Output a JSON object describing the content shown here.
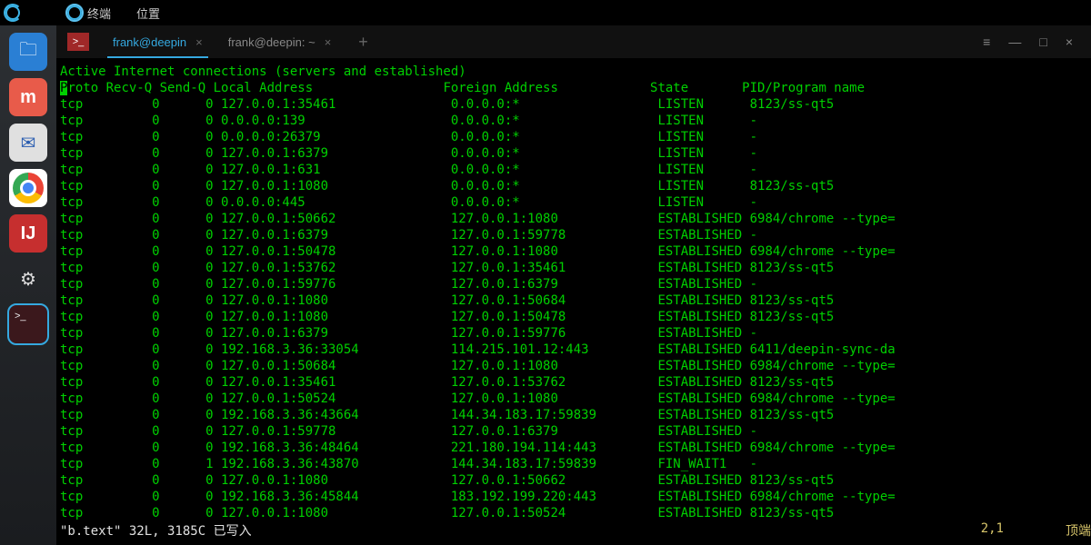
{
  "topbar": {
    "menu_terminal": "终端",
    "menu_location": "位置"
  },
  "dock": {
    "store_label": "m",
    "ij_label": "IJ"
  },
  "tabs": {
    "badge": ">_",
    "active": "frank@deepin",
    "inactive": "frank@deepin: ~",
    "close": "×",
    "plus": "+"
  },
  "winctrls": {
    "menu": "≡",
    "min": "—",
    "max": "□",
    "close": "×"
  },
  "term": {
    "title": "Active Internet connections (servers and established)",
    "headers": {
      "proto": "Proto",
      "recvq": "Recv-Q",
      "sendq": "Send-Q",
      "local": "Local Address",
      "foreign": "Foreign Address",
      "state": "State",
      "pid": "PID/Program name"
    },
    "rows": [
      {
        "proto": "tcp",
        "recv": "0",
        "send": "0",
        "local": "127.0.0.1:35461",
        "foreign": "0.0.0.0:*",
        "state": "LISTEN",
        "pid": "8123/ss-qt5"
      },
      {
        "proto": "tcp",
        "recv": "0",
        "send": "0",
        "local": "0.0.0.0:139",
        "foreign": "0.0.0.0:*",
        "state": "LISTEN",
        "pid": "-"
      },
      {
        "proto": "tcp",
        "recv": "0",
        "send": "0",
        "local": "0.0.0.0:26379",
        "foreign": "0.0.0.0:*",
        "state": "LISTEN",
        "pid": "-"
      },
      {
        "proto": "tcp",
        "recv": "0",
        "send": "0",
        "local": "127.0.0.1:6379",
        "foreign": "0.0.0.0:*",
        "state": "LISTEN",
        "pid": "-"
      },
      {
        "proto": "tcp",
        "recv": "0",
        "send": "0",
        "local": "127.0.0.1:631",
        "foreign": "0.0.0.0:*",
        "state": "LISTEN",
        "pid": "-"
      },
      {
        "proto": "tcp",
        "recv": "0",
        "send": "0",
        "local": "127.0.0.1:1080",
        "foreign": "0.0.0.0:*",
        "state": "LISTEN",
        "pid": "8123/ss-qt5"
      },
      {
        "proto": "tcp",
        "recv": "0",
        "send": "0",
        "local": "0.0.0.0:445",
        "foreign": "0.0.0.0:*",
        "state": "LISTEN",
        "pid": "-"
      },
      {
        "proto": "tcp",
        "recv": "0",
        "send": "0",
        "local": "127.0.0.1:50662",
        "foreign": "127.0.0.1:1080",
        "state": "ESTABLISHED",
        "pid": "6984/chrome --type="
      },
      {
        "proto": "tcp",
        "recv": "0",
        "send": "0",
        "local": "127.0.0.1:6379",
        "foreign": "127.0.0.1:59778",
        "state": "ESTABLISHED",
        "pid": "-"
      },
      {
        "proto": "tcp",
        "recv": "0",
        "send": "0",
        "local": "127.0.0.1:50478",
        "foreign": "127.0.0.1:1080",
        "state": "ESTABLISHED",
        "pid": "6984/chrome --type="
      },
      {
        "proto": "tcp",
        "recv": "0",
        "send": "0",
        "local": "127.0.0.1:53762",
        "foreign": "127.0.0.1:35461",
        "state": "ESTABLISHED",
        "pid": "8123/ss-qt5"
      },
      {
        "proto": "tcp",
        "recv": "0",
        "send": "0",
        "local": "127.0.0.1:59776",
        "foreign": "127.0.0.1:6379",
        "state": "ESTABLISHED",
        "pid": "-"
      },
      {
        "proto": "tcp",
        "recv": "0",
        "send": "0",
        "local": "127.0.0.1:1080",
        "foreign": "127.0.0.1:50684",
        "state": "ESTABLISHED",
        "pid": "8123/ss-qt5"
      },
      {
        "proto": "tcp",
        "recv": "0",
        "send": "0",
        "local": "127.0.0.1:1080",
        "foreign": "127.0.0.1:50478",
        "state": "ESTABLISHED",
        "pid": "8123/ss-qt5"
      },
      {
        "proto": "tcp",
        "recv": "0",
        "send": "0",
        "local": "127.0.0.1:6379",
        "foreign": "127.0.0.1:59776",
        "state": "ESTABLISHED",
        "pid": "-"
      },
      {
        "proto": "tcp",
        "recv": "0",
        "send": "0",
        "local": "192.168.3.36:33054",
        "foreign": "114.215.101.12:443",
        "state": "ESTABLISHED",
        "pid": "6411/deepin-sync-da"
      },
      {
        "proto": "tcp",
        "recv": "0",
        "send": "0",
        "local": "127.0.0.1:50684",
        "foreign": "127.0.0.1:1080",
        "state": "ESTABLISHED",
        "pid": "6984/chrome --type="
      },
      {
        "proto": "tcp",
        "recv": "0",
        "send": "0",
        "local": "127.0.0.1:35461",
        "foreign": "127.0.0.1:53762",
        "state": "ESTABLISHED",
        "pid": "8123/ss-qt5"
      },
      {
        "proto": "tcp",
        "recv": "0",
        "send": "0",
        "local": "127.0.0.1:50524",
        "foreign": "127.0.0.1:1080",
        "state": "ESTABLISHED",
        "pid": "6984/chrome --type="
      },
      {
        "proto": "tcp",
        "recv": "0",
        "send": "0",
        "local": "192.168.3.36:43664",
        "foreign": "144.34.183.17:59839",
        "state": "ESTABLISHED",
        "pid": "8123/ss-qt5"
      },
      {
        "proto": "tcp",
        "recv": "0",
        "send": "0",
        "local": "127.0.0.1:59778",
        "foreign": "127.0.0.1:6379",
        "state": "ESTABLISHED",
        "pid": "-"
      },
      {
        "proto": "tcp",
        "recv": "0",
        "send": "0",
        "local": "192.168.3.36:48464",
        "foreign": "221.180.194.114:443",
        "state": "ESTABLISHED",
        "pid": "6984/chrome --type="
      },
      {
        "proto": "tcp",
        "recv": "0",
        "send": "1",
        "local": "192.168.3.36:43870",
        "foreign": "144.34.183.17:59839",
        "state": "FIN_WAIT1",
        "pid": "-"
      },
      {
        "proto": "tcp",
        "recv": "0",
        "send": "0",
        "local": "127.0.0.1:1080",
        "foreign": "127.0.0.1:50662",
        "state": "ESTABLISHED",
        "pid": "8123/ss-qt5"
      },
      {
        "proto": "tcp",
        "recv": "0",
        "send": "0",
        "local": "192.168.3.36:45844",
        "foreign": "183.192.199.220:443",
        "state": "ESTABLISHED",
        "pid": "6984/chrome --type="
      },
      {
        "proto": "tcp",
        "recv": "0",
        "send": "0",
        "local": "127.0.0.1:1080",
        "foreign": "127.0.0.1:50524",
        "state": "ESTABLISHED",
        "pid": "8123/ss-qt5"
      }
    ]
  },
  "status": {
    "left": "\"b.text\" 32L, 3185C 已写入",
    "pos": "2,1",
    "mode": "顶端"
  }
}
